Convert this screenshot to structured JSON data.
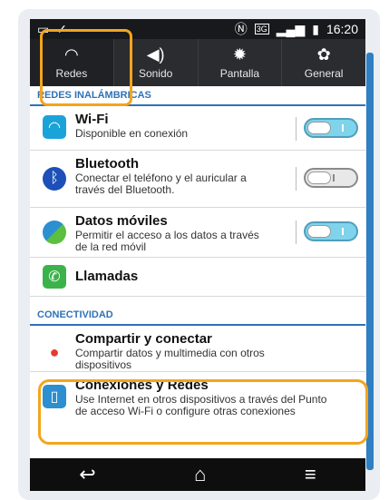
{
  "status_bar": {
    "left_icons": [
      "picture-icon",
      "check-icon"
    ],
    "nfc_icon": "nfc-icon",
    "network": "3G",
    "signal_icon": "signal-icon",
    "battery_icon": "battery-icon",
    "time": "16:20"
  },
  "tabs": [
    {
      "label": "Redes",
      "icon": "wifi-icon",
      "glyph": "◠"
    },
    {
      "label": "Sonido",
      "icon": "speaker-icon",
      "glyph": "◀)"
    },
    {
      "label": "Pantalla",
      "icon": "brightness-icon",
      "glyph": "✹"
    },
    {
      "label": "General",
      "icon": "gear-icon",
      "glyph": "✿"
    }
  ],
  "sections": {
    "wireless": "REDES INALÁMBRICAS",
    "connectivity": "CONECTIVIDAD"
  },
  "rows": {
    "wifi": {
      "title": "Wi-Fi",
      "subtitle": "Disponible en conexión",
      "toggle": "on"
    },
    "bluetooth": {
      "title": "Bluetooth",
      "subtitle": "Conectar el teléfono y el auricular a través del Bluetooth.",
      "toggle": "off"
    },
    "mobile_data": {
      "title": "Datos móviles",
      "subtitle": "Permitir el acceso a los datos a través de la red móvil",
      "toggle": "on"
    },
    "calls": {
      "title": "Llamadas"
    },
    "share": {
      "title": "Compartir y conectar",
      "subtitle": "Compartir datos y multimedia con otros dispositivos"
    },
    "tethering": {
      "title": "Conexiones y Redes",
      "subtitle": "Use Internet en otros dispositivos a través del Punto de acceso Wi-Fi o configure otras conexiones"
    }
  },
  "nav_bar": {
    "back_icon": "back-icon",
    "home_icon": "home-icon",
    "menu_icon": "menu-icon"
  },
  "colors": {
    "accent": "#2e72b8",
    "highlight": "#f3a51c",
    "toggle_on": "#7fd3ea"
  }
}
